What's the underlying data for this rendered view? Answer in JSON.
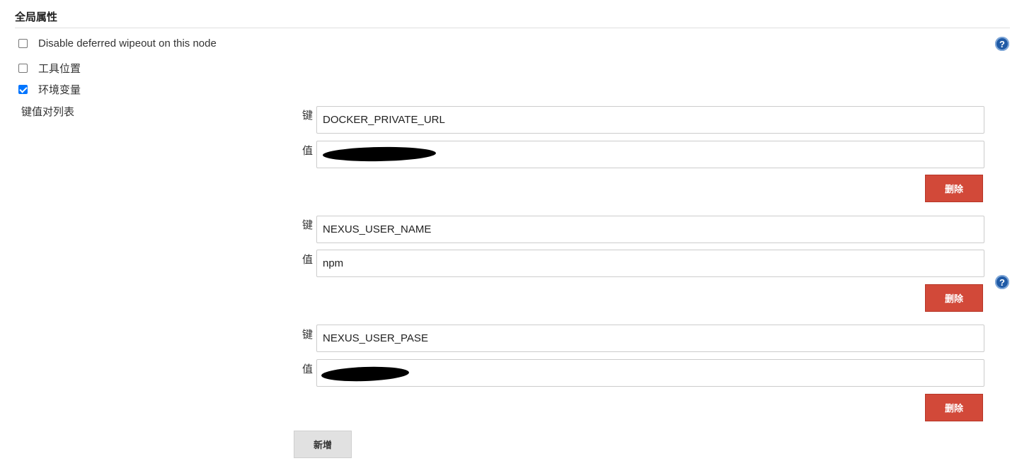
{
  "section": {
    "title": "全局属性"
  },
  "options": [
    {
      "label": "Disable deferred wipeout on this node",
      "checked": false
    },
    {
      "label": "工具位置",
      "checked": false
    },
    {
      "label": "环境变量",
      "checked": true
    }
  ],
  "env_vars": {
    "title": "键值对列表",
    "key_label": "键",
    "value_label": "值",
    "delete_label": "删除",
    "add_label": "新增",
    "entries": [
      {
        "key": "DOCKER_PRIVATE_URL",
        "value": "",
        "value_redacted": true
      },
      {
        "key": "NEXUS_USER_NAME",
        "value": "npm",
        "value_redacted": false
      },
      {
        "key": "NEXUS_USER_PASE",
        "value": "",
        "value_redacted": true
      }
    ]
  },
  "help": {
    "glyph": "?"
  },
  "icons": {
    "help": "help-icon",
    "checkbox": "checkbox-icon"
  },
  "colors": {
    "delete_button": "#d24939",
    "add_button": "#e1e1e1",
    "help_icon": "#1f5aa6",
    "checkbox_checked": "#0075ff"
  }
}
